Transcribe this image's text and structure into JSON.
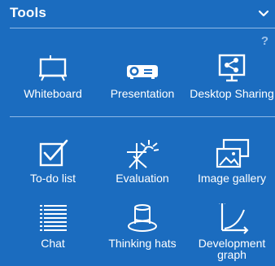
{
  "header": {
    "title": "Tools"
  },
  "help": {
    "label": "?"
  },
  "tools": [
    {
      "label": "Whiteboard",
      "icon": "whiteboard-icon"
    },
    {
      "label": "Presentation",
      "icon": "projector-icon"
    },
    {
      "label": "Desktop Sharing",
      "icon": "desktop-sharing-icon"
    },
    {
      "label": "To-do list",
      "icon": "checkbox-icon"
    },
    {
      "label": "Evaluation",
      "icon": "evaluation-icon"
    },
    {
      "label": "Image gallery",
      "icon": "image-gallery-icon"
    },
    {
      "label": "Chat",
      "icon": "chat-lines-icon"
    },
    {
      "label": "Thinking hats",
      "icon": "top-hat-icon"
    },
    {
      "label": "Development\ngraph",
      "icon": "growth-graph-icon"
    }
  ],
  "colors": {
    "background": "#1b6cbf",
    "rule": "#8fb9e6",
    "text": "#ffffff"
  }
}
